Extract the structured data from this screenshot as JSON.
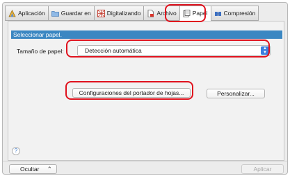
{
  "tabs": [
    {
      "label": "Aplicación",
      "icon": "application-icon"
    },
    {
      "label": "Guardar en",
      "icon": "folder-icon"
    },
    {
      "label": "Digitalizando",
      "icon": "scanning-icon"
    },
    {
      "label": "Archivo",
      "icon": "file-icon"
    },
    {
      "label": "Papel",
      "icon": "paper-icon",
      "active": true
    },
    {
      "label": "Compresión",
      "icon": "compression-icon"
    }
  ],
  "section": {
    "title": "Seleccionar papel."
  },
  "paper_size": {
    "label": "Tamaño de papel:",
    "value": "Detección automática"
  },
  "buttons": {
    "carrier_settings": "Configuraciones del portador de hojas...",
    "customize": "Personalizar...",
    "help": "?",
    "hide": "Ocultar",
    "apply": "Aplicar"
  },
  "colors": {
    "accent": "#3b87c2",
    "highlight": "#e0111d"
  }
}
